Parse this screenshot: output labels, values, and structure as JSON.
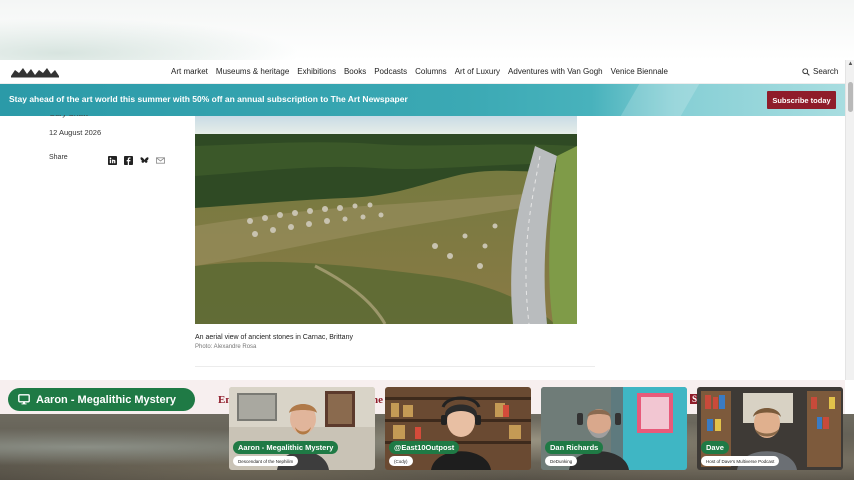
{
  "nav": {
    "items": [
      "Art market",
      "Museums & heritage",
      "Exhibitions",
      "Books",
      "Podcasts",
      "Columns",
      "Art of Luxury",
      "Adventures with Van Gogh",
      "Venice Biennale"
    ],
    "search_label": "Search"
  },
  "promo": {
    "text": "Stay ahead of the art world this summer with 50% off an annual subscription to The Art Newspaper",
    "button": "Subscribe today"
  },
  "article": {
    "author": "Gary Shaw",
    "date": "12 August 2026",
    "share_label": "Share",
    "share_icons": [
      "linkedin-icon",
      "facebook-icon",
      "bluesky-icon",
      "email-icon"
    ],
    "caption": "An aerial view of ancient stones in Carnac, Brittany",
    "credit": "Photo: Alexandre Rosa"
  },
  "strip": {
    "left": "En",
    "middle": "he",
    "right": "Su"
  },
  "stream": {
    "host_pill": "Aaron - Megalithic Mystery",
    "tiles": [
      {
        "name": "Aaron - Megalithic Mystery",
        "sub": "Descendant of the Nephilim"
      },
      {
        "name": "@East10Outpost",
        "sub": "(Cody)"
      },
      {
        "name": "Dan Richards",
        "sub": "DeDunking"
      },
      {
        "name": "Dave",
        "sub": "Host of Dave's Multiverse Podcast"
      }
    ]
  },
  "colors": {
    "accent_green": "#1f7a45",
    "banner_teal": "#2b9aa8",
    "subscribe_red": "#8f1c2a"
  }
}
